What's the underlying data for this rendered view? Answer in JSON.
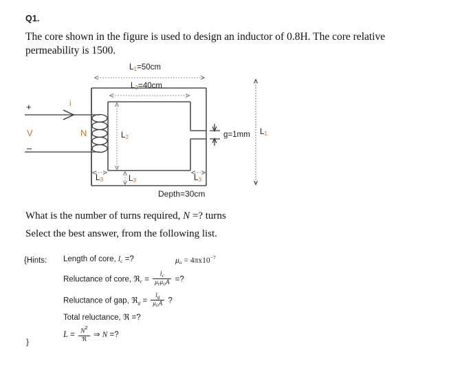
{
  "question": {
    "number": "Q1.",
    "stem": "The core shown in the figure is used to design an inductor of 0.8H.  The core relative permeability is 1500.",
    "ask": "What is the number of turns required, ",
    "ask_symbol": "N",
    "ask_tail": " =? turns",
    "select_line": "Select the best answer, from the following list."
  },
  "figure": {
    "dim_l1_top": {
      "base": "L",
      "sub": "1",
      "value": "=50cm"
    },
    "dim_l2_top": {
      "base": "L",
      "sub": "2",
      "value": "=40cm"
    },
    "dim_l2_side": {
      "base": "L",
      "sub": "2"
    },
    "dim_l1_right": {
      "base": "L",
      "sub": "1"
    },
    "dim_l3_left": {
      "base": "L",
      "sub": "3"
    },
    "dim_l3_bottom": {
      "base": "L",
      "sub": "3"
    },
    "dim_l3_right": {
      "base": "L",
      "sub": "3"
    },
    "gap_label": "g=1mm",
    "depth_label": "Depth=30cm",
    "current_label": "i",
    "turns_label": "N",
    "voltage_label": "V",
    "plus_label": "+",
    "minus_label": "–",
    "accent_color": "#c1752a",
    "core_color": "#4d4d4d",
    "dim_color": "#808080"
  },
  "hints": {
    "open_brace": "{Hints:",
    "close_brace": "}",
    "line1_text": "Length of core, ",
    "line1_sym": "l",
    "line1_sub": "c",
    "line1_tail": " =?",
    "mu0_text": "μ",
    "mu0_sub": "o",
    "mu0_value": " = 4πx10",
    "mu0_exp": "−7",
    "line2_text": "Reluctance of core, ",
    "line2_sym": "ℜ",
    "line2_sub": "c",
    "line2_eq": " = ",
    "line2_num": "l",
    "line2_num_sub": "c",
    "line2_den": "μ",
    "line2_den_sub1": "r",
    "line2_den_mu": "μ",
    "line2_den_sub2": "o",
    "line2_den_A": "A",
    "line2_tail": " =?",
    "line3_text": "Reluctance of gap, ",
    "line3_sym": "ℜ",
    "line3_sub": "g",
    "line3_eq": " = ",
    "line3_num": "l",
    "line3_num_sub": "g",
    "line3_den": "μ",
    "line3_den_sub": "o",
    "line3_den_A": "A",
    "line3_tail": " ?",
    "line4_text": "Total reluctance, ",
    "line4_sym": "ℜ",
    "line4_tail": " =?",
    "line5_L": "L",
    "line5_eq": " = ",
    "line5_num": "N",
    "line5_num_sup": "2",
    "line5_den": "ℜ",
    "line5_arrow": " ⇒ ",
    "line5_N": "N",
    "line5_tail": " =?"
  }
}
